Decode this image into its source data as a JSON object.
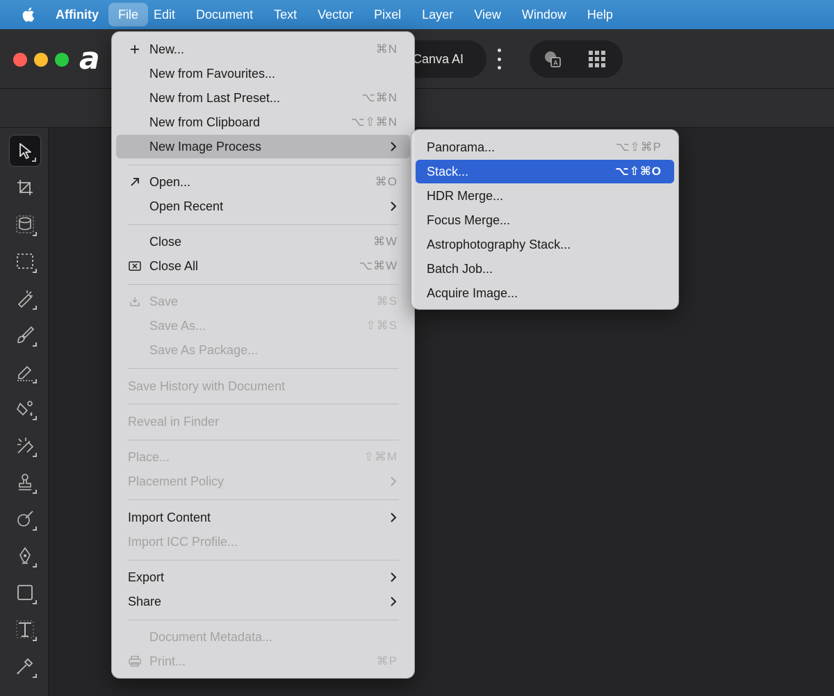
{
  "menubar": {
    "app_name": "Affinity",
    "items": [
      "File",
      "Edit",
      "Document",
      "Text",
      "Vector",
      "Pixel",
      "Layer",
      "View",
      "Window",
      "Help"
    ],
    "active_item": "File"
  },
  "window": {
    "logo_text": "a",
    "canva_ai_label": "Canva AI"
  },
  "file_menu": {
    "new": {
      "label": "New...",
      "shortcut": "⌘N",
      "icon": "plus-icon"
    },
    "new_from_favourites": {
      "label": "New from Favourites..."
    },
    "new_from_last_preset": {
      "label": "New from Last Preset...",
      "shortcut": "⌥⌘N"
    },
    "new_from_clipboard": {
      "label": "New from Clipboard",
      "shortcut": "⌥⇧⌘N"
    },
    "new_image_process": {
      "label": "New Image Process",
      "has_submenu": true,
      "state": "hover"
    },
    "open": {
      "label": "Open...",
      "shortcut": "⌘O",
      "icon": "arrow-up-right-icon"
    },
    "open_recent": {
      "label": "Open Recent",
      "has_submenu": true
    },
    "close": {
      "label": "Close",
      "shortcut": "⌘W"
    },
    "close_all": {
      "label": "Close All",
      "shortcut": "⌥⌘W",
      "icon": "close-all-icon"
    },
    "save": {
      "label": "Save",
      "shortcut": "⌘S",
      "icon": "save-icon",
      "disabled": true
    },
    "save_as": {
      "label": "Save As...",
      "shortcut": "⇧⌘S",
      "disabled": true
    },
    "save_as_package": {
      "label": "Save As Package...",
      "disabled": true
    },
    "save_history": {
      "label": "Save History with Document",
      "disabled": true
    },
    "reveal_in_finder": {
      "label": "Reveal in Finder",
      "disabled": true
    },
    "place": {
      "label": "Place...",
      "shortcut": "⇧⌘M",
      "disabled": true
    },
    "placement_policy": {
      "label": "Placement Policy",
      "has_submenu": true,
      "disabled": true
    },
    "import_content": {
      "label": "Import Content",
      "has_submenu": true
    },
    "import_icc_profile": {
      "label": "Import ICC Profile...",
      "disabled": true
    },
    "export": {
      "label": "Export",
      "has_submenu": true
    },
    "share": {
      "label": "Share",
      "has_submenu": true
    },
    "document_metadata": {
      "label": "Document Metadata...",
      "disabled": true
    },
    "print": {
      "label": "Print...",
      "shortcut": "⌘P",
      "icon": "printer-icon",
      "disabled": true
    }
  },
  "submenu": {
    "panorama": {
      "label": "Panorama...",
      "shortcut": "⌥⇧⌘P"
    },
    "stack": {
      "label": "Stack...",
      "shortcut": "⌥⇧⌘O",
      "state": "highlighted"
    },
    "hdr_merge": {
      "label": "HDR Merge..."
    },
    "focus_merge": {
      "label": "Focus Merge..."
    },
    "astrophotography_stack": {
      "label": "Astrophotography Stack..."
    },
    "batch_job": {
      "label": "Batch Job..."
    },
    "acquire_image": {
      "label": "Acquire Image..."
    }
  },
  "colors": {
    "menubar": "#3286c9",
    "highlight": "#2f63d4",
    "app_background": "#252527"
  }
}
